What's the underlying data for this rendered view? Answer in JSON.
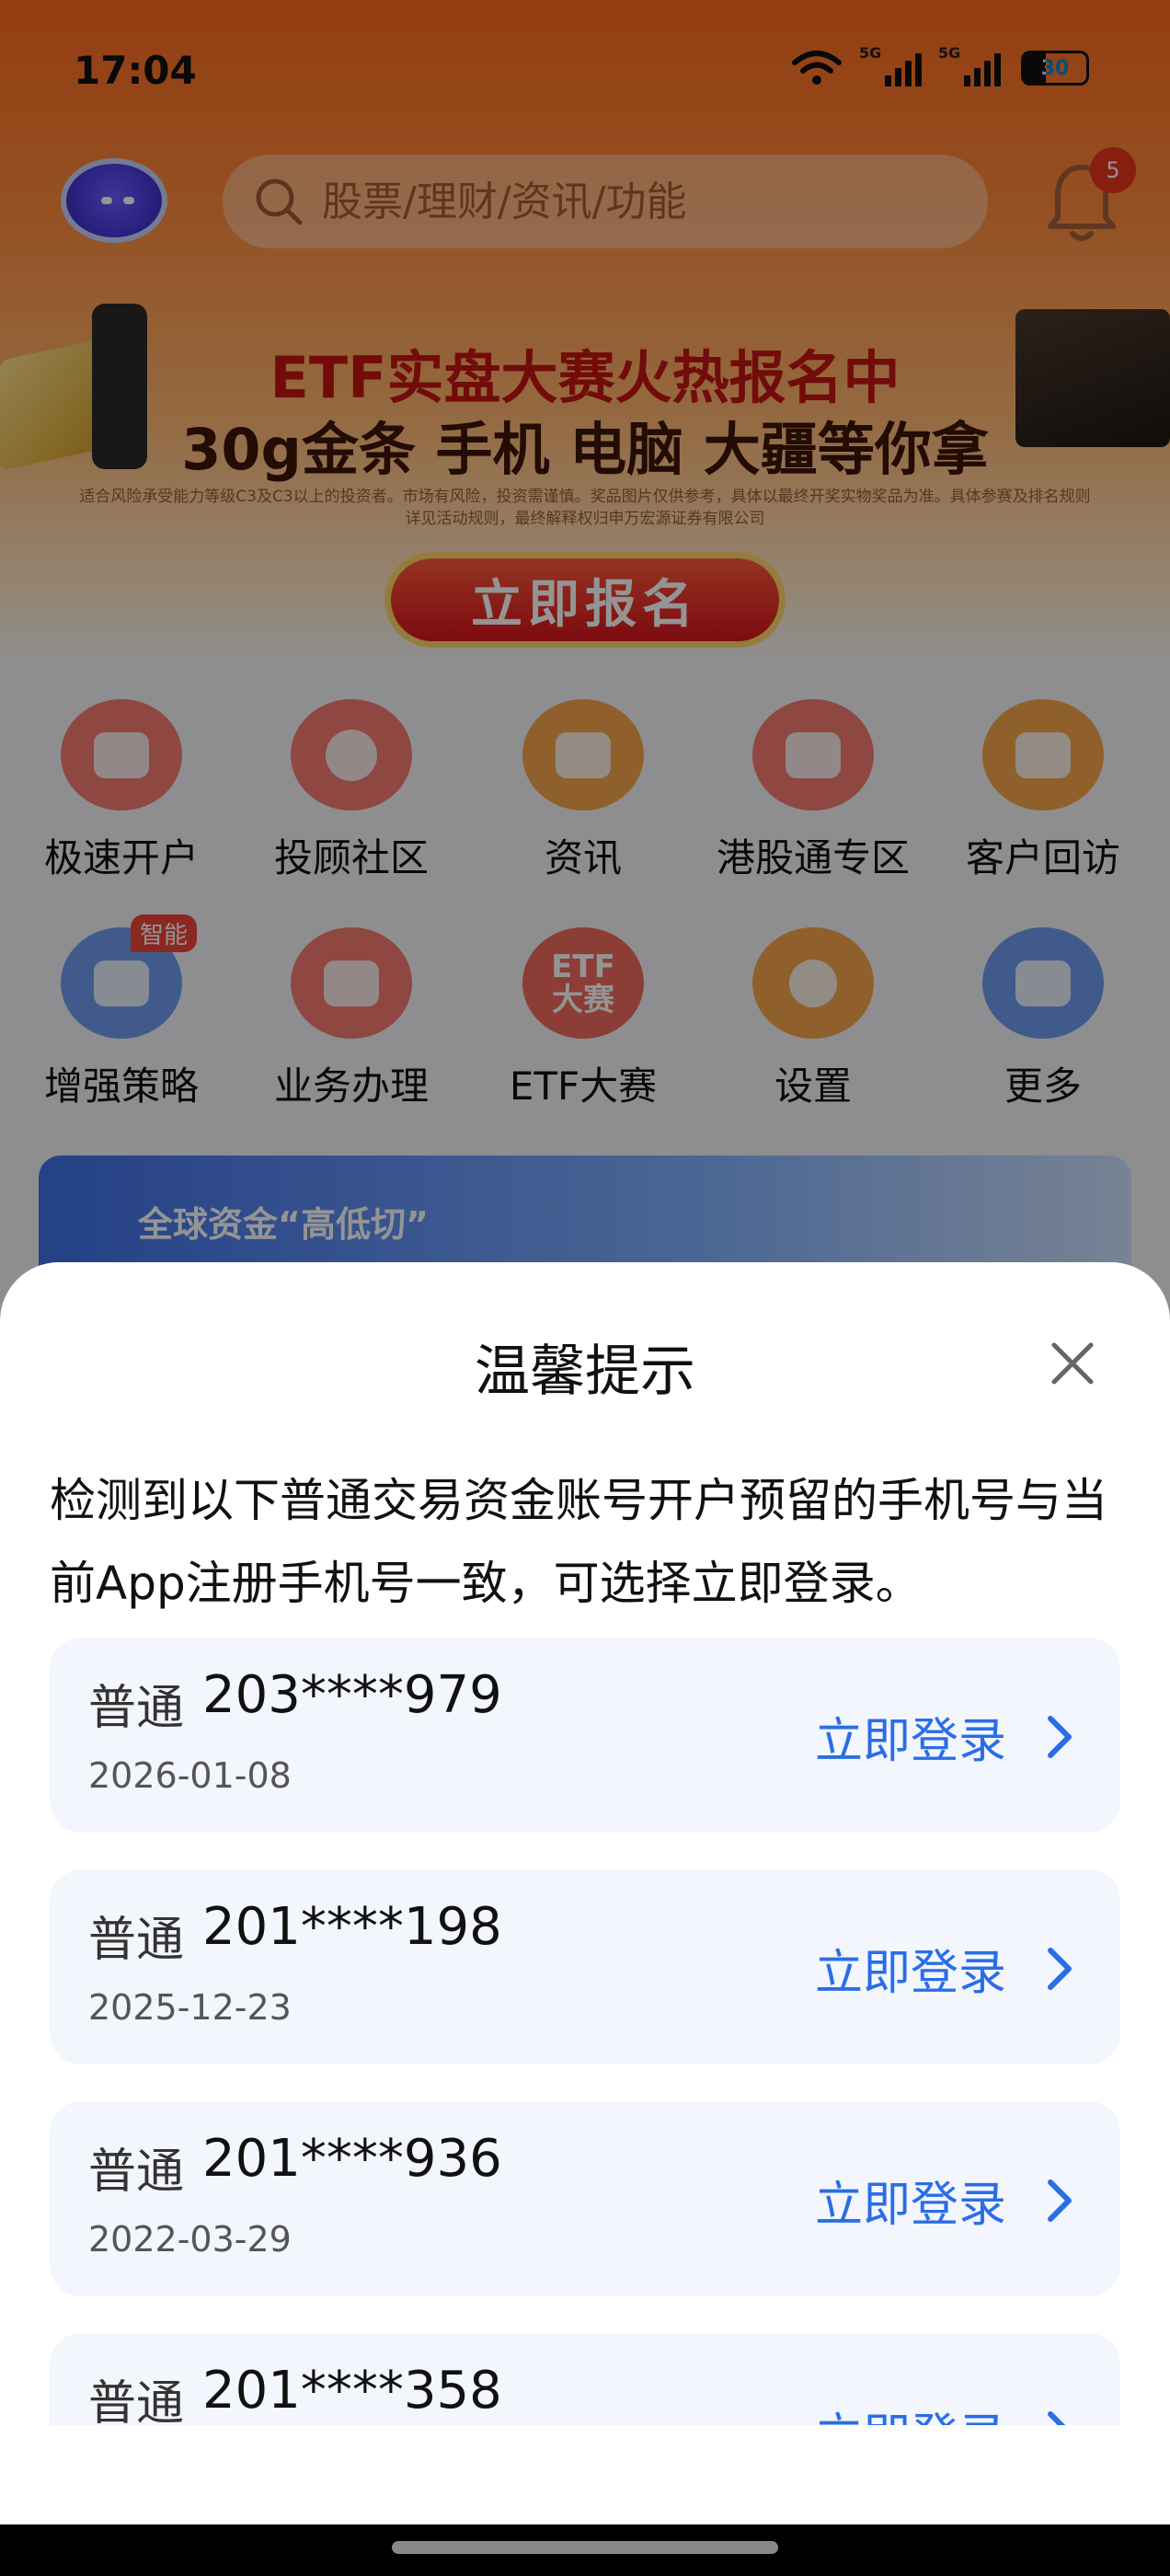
{
  "status_bar": {
    "time": "17:04",
    "signal1_label": "5G",
    "signal2_label": "5G",
    "battery": "30"
  },
  "header": {
    "search_placeholder": "股票/理财/资讯/功能",
    "notification_count": "5"
  },
  "banner": {
    "title": "ETF实盘大赛火热报名中",
    "subtitle": "30g金条 手机 电脑 大疆等你拿",
    "fine_print": "适合风险承受能力等级C3及C3以上的投资者。市场有风险，投资需谨慎。奖品图片仅供参考，具体以最终开奖实物奖品为准。具体参赛及排名规则详见活动规则，最终解释权归申万宏源证券有限公司",
    "button": "立即报名"
  },
  "quick_menu": {
    "row1": [
      "极速开户",
      "投顾社区",
      "资讯",
      "港股通专区",
      "客户回访"
    ],
    "row2": [
      "增强策略",
      "业务办理",
      "ETF大赛",
      "设置",
      "更多"
    ],
    "smart_tag": "智能",
    "etf_icon_text_line1": "ETF",
    "etf_icon_text_line2": "大赛"
  },
  "promo": {
    "text": "全球资金“高低切”"
  },
  "dialog": {
    "title": "温馨提示",
    "description": "检测到以下普通交易资金账号开户预留的手机号与当前App注册手机号一致，可选择立即登录。",
    "accounts": [
      {
        "type": "普通",
        "number": "203****979",
        "date": "2026-01-08",
        "action": "立即登录"
      },
      {
        "type": "普通",
        "number": "201****198",
        "date": "2025-12-23",
        "action": "立即登录"
      },
      {
        "type": "普通",
        "number": "201****936",
        "date": "2022-03-29",
        "action": "立即登录"
      },
      {
        "type": "普通",
        "number": "201****358",
        "date": "",
        "action": "立即登录"
      }
    ]
  },
  "colors": {
    "accent_blue": "#2a6ee6",
    "brand_orange": "#ff6a1e",
    "card_bg": "#f3f6fd"
  }
}
